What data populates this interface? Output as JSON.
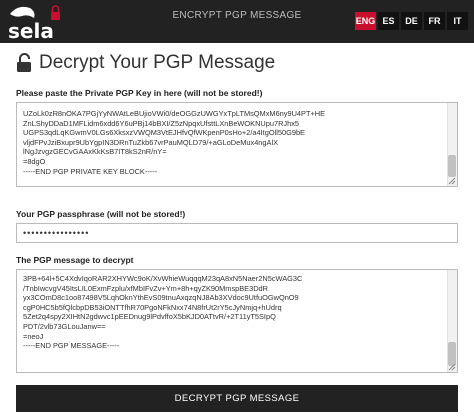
{
  "header": {
    "title": "ENCRYPT PGP MESSAGE",
    "logo_text": "sela",
    "languages": [
      {
        "label": "ENG",
        "active": true
      },
      {
        "label": "ES",
        "active": false
      },
      {
        "label": "DE",
        "active": false
      },
      {
        "label": "FR",
        "active": false
      },
      {
        "label": "IT",
        "active": false
      }
    ],
    "colors": {
      "bar": "#222222",
      "active_lang": "#c8102e"
    }
  },
  "page": {
    "title": "Decrypt Your PGP Message",
    "icon": "unlock-icon"
  },
  "private_key": {
    "label": "Please paste the Private PGP Key in here (will not be stored!)",
    "value": "UZoLk0zR8nOKA7PGjYyNWAtLeBUjioVWi0/deOGGzUWGYxTpLTMsQMxM6ny9U4PT+HE\nZnLShyDDaD1MFLidm6xdd6Y6uPBj14bBXI/Z5zNpqxUfsttLXnBeWOKNUpu7RJhx5\nUGPS3qdLqKGwmV0LGs6XksxzVWQM3VtEJHfvQfWKpenP0sHo+2/a4ItgOll50G9bE\nvljdFPvJziBxupr9UbYgpIN3DRnTuZkb67vrPauMQLD79/+aGLoDeMux4ngAlX\nlNgJzvgzGECvGAAxKkKsB7IT8kS2nR/nY=\n=8dgO\n-----END PGP PRIVATE KEY BLOCK-----"
  },
  "passphrase": {
    "label": "Your PGP passphrase (will not be stored!)",
    "value": "••••••••••••••••"
  },
  "message": {
    "label": "The PGP message to decrypt",
    "value": "3PB+64l+5C4XdvIqoRAR2XHYWc9oK/XvWhieWuqqqM23qA8xN5Naer2N5cWAG3C\n/TnbIwcvgV45ItsLIL0ExmFzplu/xfMbIFvZv+Ym+8h+qyZK90MmspBE3DdR\nyx3COmD8c1oo87498V5LqhOknYthEvS09tnuAxqzqNJ8Ab3XVdoc9UtfuOGwQnO9\ncgP0HC5b5fQlcbpDB53iONTTfhR70PgoNFkNxx74N8frUt2rY5cJyNmjq+hUdrq\n5Zet2q4spy2XIHtN2gdwvc1pEEDnug9lPdvffoX5bKJD0ATtvR/+2T11yT5SIpQ\nPDT/2vlb73GLouJanw==\n=neoJ\n-----END PGP MESSAGE-----"
  },
  "submit": {
    "label": "DECRYPT PGP MESSAGE"
  }
}
